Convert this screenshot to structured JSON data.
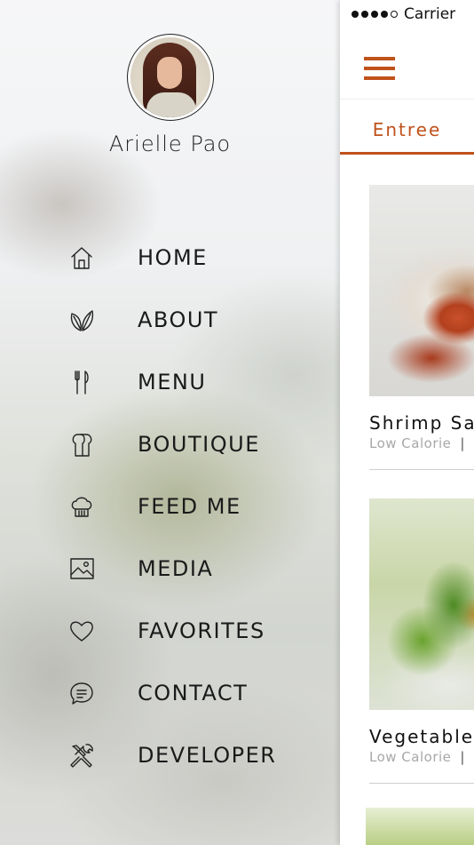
{
  "drawer": {
    "user_name": "Arielle Pao",
    "items": [
      {
        "label": "HOME",
        "icon": "home-icon"
      },
      {
        "label": "ABOUT",
        "icon": "leaf-icon"
      },
      {
        "label": "MENU",
        "icon": "fork-knife-icon"
      },
      {
        "label": "BOUTIQUE",
        "icon": "bread-icon"
      },
      {
        "label": "FEED ME",
        "icon": "chef-hat-icon"
      },
      {
        "label": "MEDIA",
        "icon": "image-icon"
      },
      {
        "label": "FAVORITES",
        "icon": "heart-icon"
      },
      {
        "label": "CONTACT",
        "icon": "chat-icon"
      },
      {
        "label": "DEVELOPER",
        "icon": "tools-icon"
      }
    ]
  },
  "status_bar": {
    "carrier": "Carrier"
  },
  "main": {
    "tab": "Entree",
    "accent_color": "#c0521b",
    "cards": [
      {
        "title": "Shrimp Sa",
        "meta": "Low Calorie",
        "sep": "|"
      },
      {
        "title": "Vegetable",
        "meta": "Low Calorie",
        "sep": "|"
      }
    ]
  }
}
